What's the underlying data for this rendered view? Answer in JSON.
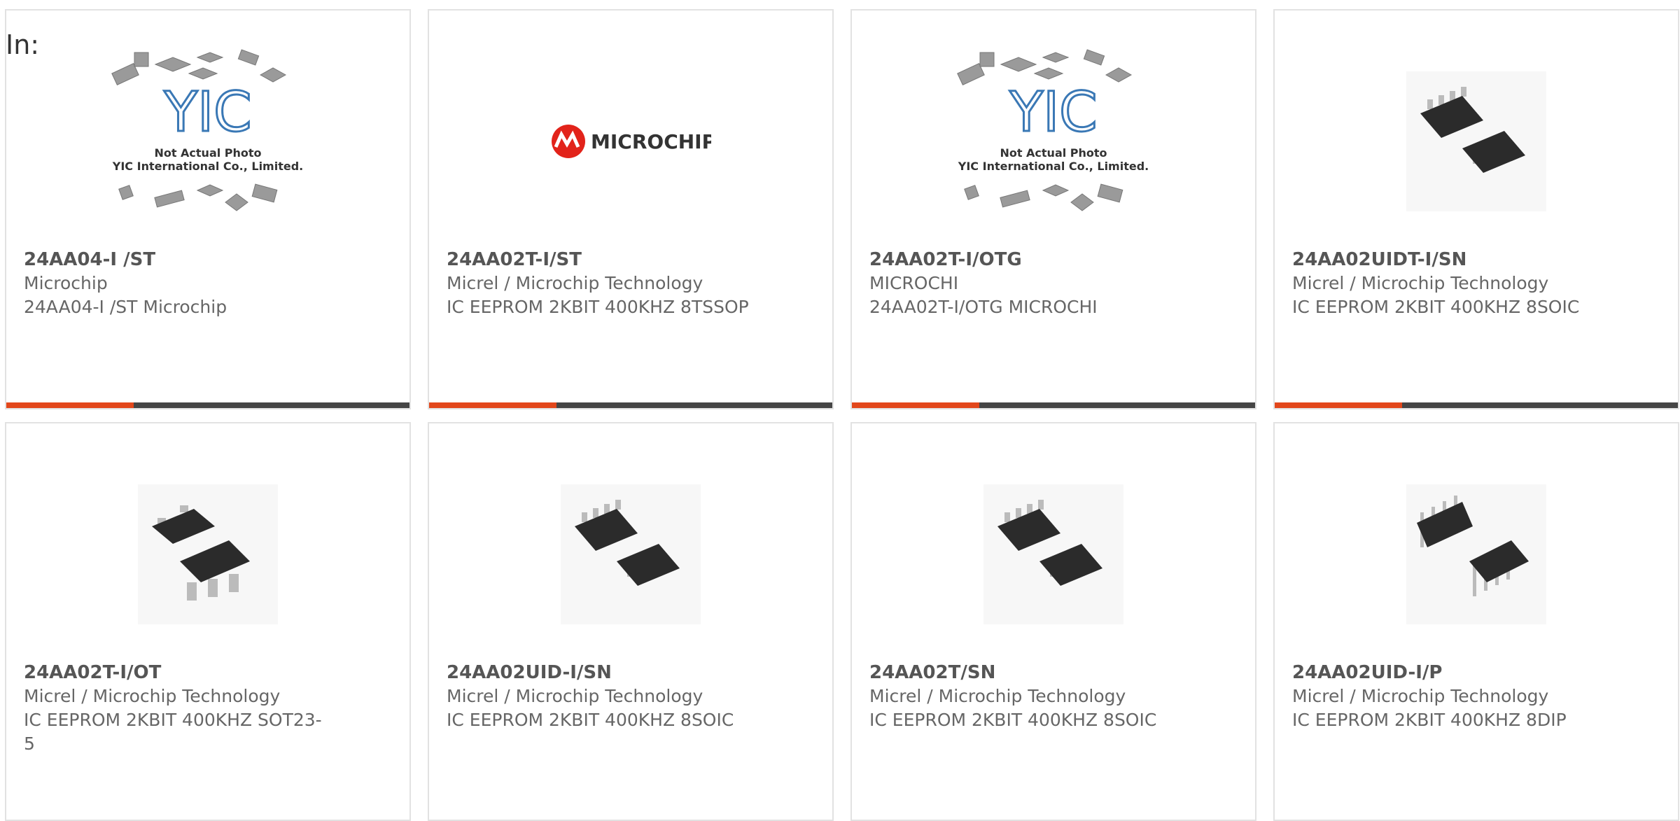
{
  "header": {
    "in_label": "In:"
  },
  "accent_color": "#e2471b",
  "bar_color": "#454545",
  "products": [
    {
      "part": "24AA04-I /ST",
      "maker": "Microchip",
      "desc": "24AA04-I /ST Microchip",
      "image": "not-actual-photo"
    },
    {
      "part": "24AA02T-I/ST",
      "maker": "Micrel / Microchip Technology",
      "desc": "IC EEPROM 2KBIT 400KHZ 8TSSOP",
      "image": "microchip-logo"
    },
    {
      "part": "24AA02T-I/OTG",
      "maker": "MICROCHI",
      "desc": "24AA02T-I/OTG MICROCHI",
      "image": "not-actual-photo"
    },
    {
      "part": "24AA02UIDT-I/SN",
      "maker": "Micrel / Microchip Technology",
      "desc": "IC EEPROM 2KBIT 400KHZ 8SOIC",
      "image": "soic-8"
    },
    {
      "part": "24AA02T-I/OT",
      "maker": "Micrel / Microchip Technology",
      "desc": "IC EEPROM 2KBIT 400KHZ SOT23-5",
      "image": "sot23-5"
    },
    {
      "part": "24AA02UID-I/SN",
      "maker": "Micrel / Microchip Technology",
      "desc": "IC EEPROM 2KBIT 400KHZ 8SOIC",
      "image": "soic-8"
    },
    {
      "part": "24AA02T/SN",
      "maker": "Micrel / Microchip Technology",
      "desc": "IC EEPROM 2KBIT 400KHZ 8SOIC",
      "image": "soic-8"
    },
    {
      "part": "24AA02UID-I/P",
      "maker": "Micrel / Microchip Technology",
      "desc": "IC EEPROM 2KBIT 400KHZ 8DIP",
      "image": "dip-8"
    }
  ],
  "placeholder_image": {
    "line1": "Not Actual Photo",
    "line2": "YIC International Co., Limited.",
    "logo_text": "YIC"
  },
  "brand_logo": {
    "text": "MICROCHIP",
    "color": "#e2231a"
  }
}
